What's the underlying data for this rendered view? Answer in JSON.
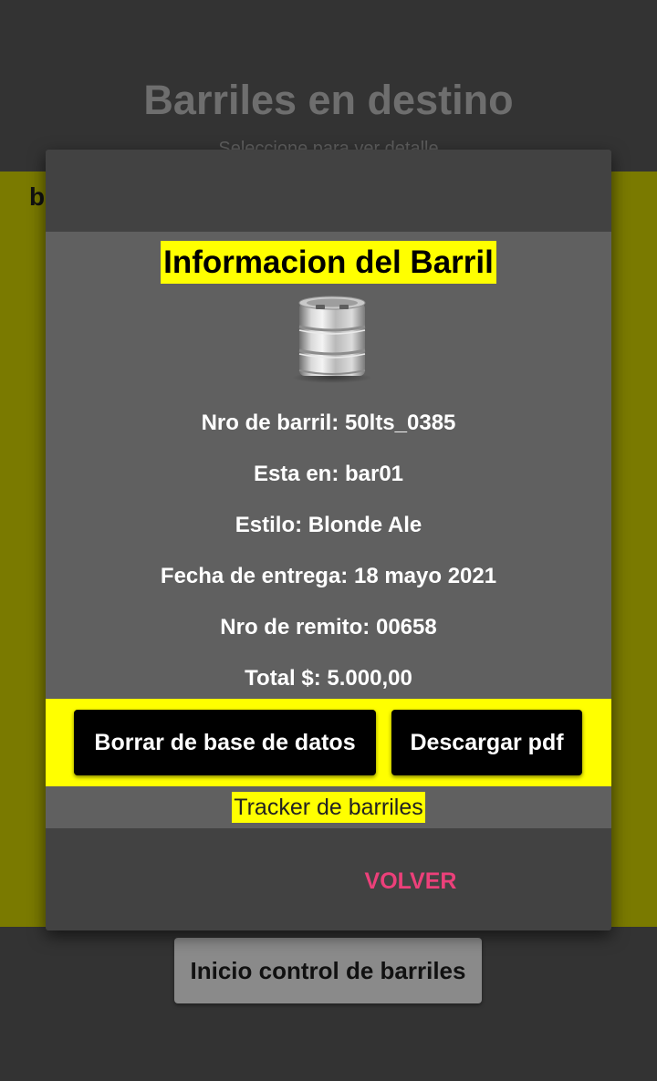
{
  "background": {
    "title": "Barriles en destino",
    "subtitle": "Seleccione para ver detalle",
    "panel_text": "b",
    "bottom_button": "Inicio control de barriles"
  },
  "dialog": {
    "title": "Informacion del Barril",
    "keg_icon": "beer-keg-icon",
    "lines": {
      "barrel_number": "Nro de barril: 50lts_0385",
      "location": "Esta en:  bar01",
      "style": "Estilo:  Blonde Ale",
      "delivery_date": "Fecha de entrega:  18 mayo 2021",
      "remito": "Nro de remito: 00658",
      "total": "Total $: 5.000,00"
    },
    "buttons": {
      "delete": "Borrar de base de datos",
      "download_pdf": "Descargar pdf"
    },
    "tracker_link": "Tracker de barriles",
    "back_button": "VOLVER"
  },
  "colors": {
    "highlight_yellow": "#ffff00",
    "accent_pink": "#ec407a",
    "olive_panel": "#7a7a00"
  }
}
